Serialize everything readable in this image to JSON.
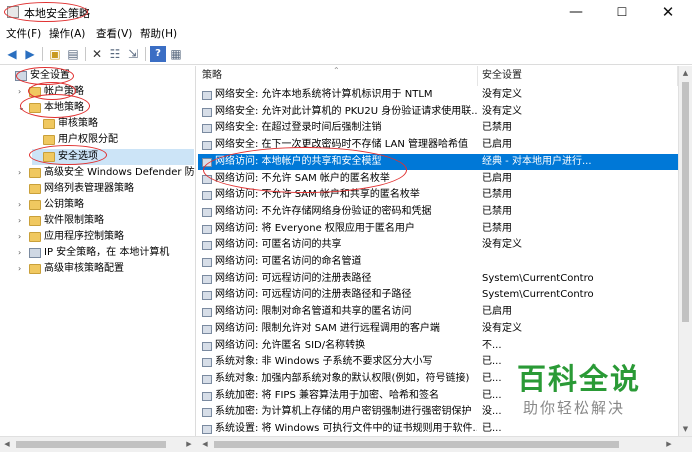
{
  "window": {
    "title": "本地安全策略",
    "min_glyph": "—",
    "max_glyph": "☐",
    "close_glyph": "✕"
  },
  "menu": [
    "文件(F)",
    "操作(A)",
    "查看(V)",
    "帮助(H)"
  ],
  "toolbar": {
    "icons": [
      "back-arrow-icon",
      "forward-arrow-icon",
      "up-folder-icon",
      "show-tree-icon",
      "delete-icon",
      "properties-icon",
      "export-icon",
      "help-icon",
      "view-icon"
    ]
  },
  "tree": {
    "items": [
      {
        "label": "安全设置",
        "level": 0,
        "expand": "",
        "icon": "shield"
      },
      {
        "label": "帐户策略",
        "level": 1,
        "expand": "›",
        "icon": "folder"
      },
      {
        "label": "本地策略",
        "level": 1,
        "expand": "⌄",
        "icon": "folder"
      },
      {
        "label": "审核策略",
        "level": 2,
        "expand": "",
        "icon": "folder"
      },
      {
        "label": "用户权限分配",
        "level": 2,
        "expand": "",
        "icon": "folder"
      },
      {
        "label": "安全选项",
        "level": 2,
        "expand": "",
        "icon": "folder"
      },
      {
        "label": "高级安全 Windows Defender 防火墙",
        "level": 1,
        "expand": "›",
        "icon": "folder"
      },
      {
        "label": "网络列表管理器策略",
        "level": 1,
        "expand": "",
        "icon": "folder"
      },
      {
        "label": "公钥策略",
        "level": 1,
        "expand": "›",
        "icon": "folder"
      },
      {
        "label": "软件限制策略",
        "level": 1,
        "expand": "›",
        "icon": "folder"
      },
      {
        "label": "应用程序控制策略",
        "level": 1,
        "expand": "›",
        "icon": "folder"
      },
      {
        "label": "IP 安全策略，在 本地计算机",
        "level": 1,
        "expand": "›",
        "icon": "shield"
      },
      {
        "label": "高级审核策略配置",
        "level": 1,
        "expand": "›",
        "icon": "folder"
      }
    ],
    "selected_index": 5
  },
  "list": {
    "col_policy": "策略",
    "col_setting": "安全设置",
    "rows": [
      {
        "policy": "网络安全: 允许本地系统将计算机标识用于 NTLM",
        "setting": "没有定义"
      },
      {
        "policy": "网络安全: 允许对此计算机的 PKU2U 身份验证请求使用联...",
        "setting": "没有定义"
      },
      {
        "policy": "网络安全: 在超过登录时间后强制注销",
        "setting": "已禁用"
      },
      {
        "policy": "网络安全: 在下一次更改密码时不存储 LAN 管理器哈希值",
        "setting": "已启用"
      },
      {
        "policy": "网络访问: 本地帐户的共享和安全模型",
        "setting": "经典 - 对本地用户进行..."
      },
      {
        "policy": "网络访问: 不允许 SAM 帐户的匿名枚举",
        "setting": "已启用"
      },
      {
        "policy": "网络访问: 不允许 SAM 帐户和共享的匿名枚举",
        "setting": "已禁用"
      },
      {
        "policy": "网络访问: 不允许存储网络身份验证的密码和凭据",
        "setting": "已禁用"
      },
      {
        "policy": "网络访问: 将 Everyone 权限应用于匿名用户",
        "setting": "已禁用"
      },
      {
        "policy": "网络访问: 可匿名访问的共享",
        "setting": "没有定义"
      },
      {
        "policy": "网络访问: 可匿名访问的命名管道",
        "setting": ""
      },
      {
        "policy": "网络访问: 可远程访问的注册表路径",
        "setting": "System\\CurrentContro..."
      },
      {
        "policy": "网络访问: 可远程访问的注册表路径和子路径",
        "setting": "System\\CurrentContro..."
      },
      {
        "policy": "网络访问: 限制对命名管道和共享的匿名访问",
        "setting": "已启用"
      },
      {
        "policy": "网络访问: 限制允许对 SAM 进行远程调用的客户端",
        "setting": "没有定义"
      },
      {
        "policy": "网络访问: 允许匿名 SID/名称转换",
        "setting": "不..."
      },
      {
        "policy": "系统对象: 非 Windows 子系统不要求区分大小写",
        "setting": "已..."
      },
      {
        "policy": "系统对象: 加强内部系统对象的默认权限(例如，符号链接)",
        "setting": "已..."
      },
      {
        "policy": "系统加密: 将 FIPS 兼容算法用于加密、哈希和签名",
        "setting": "已..."
      },
      {
        "policy": "系统加密: 为计算机上存储的用户密钥强制进行强密钥保护",
        "setting": "没..."
      },
      {
        "policy": "系统设置: 将 Windows 可执行文件中的证书规则用于软件...",
        "setting": "已..."
      }
    ],
    "selected_index": 4
  },
  "watermark": {
    "title": "百科全说",
    "subtitle": "助你轻松解决",
    "color": "#2a9a36"
  },
  "colors": {
    "selection": "#0078d7",
    "annotation": "#e03030"
  }
}
